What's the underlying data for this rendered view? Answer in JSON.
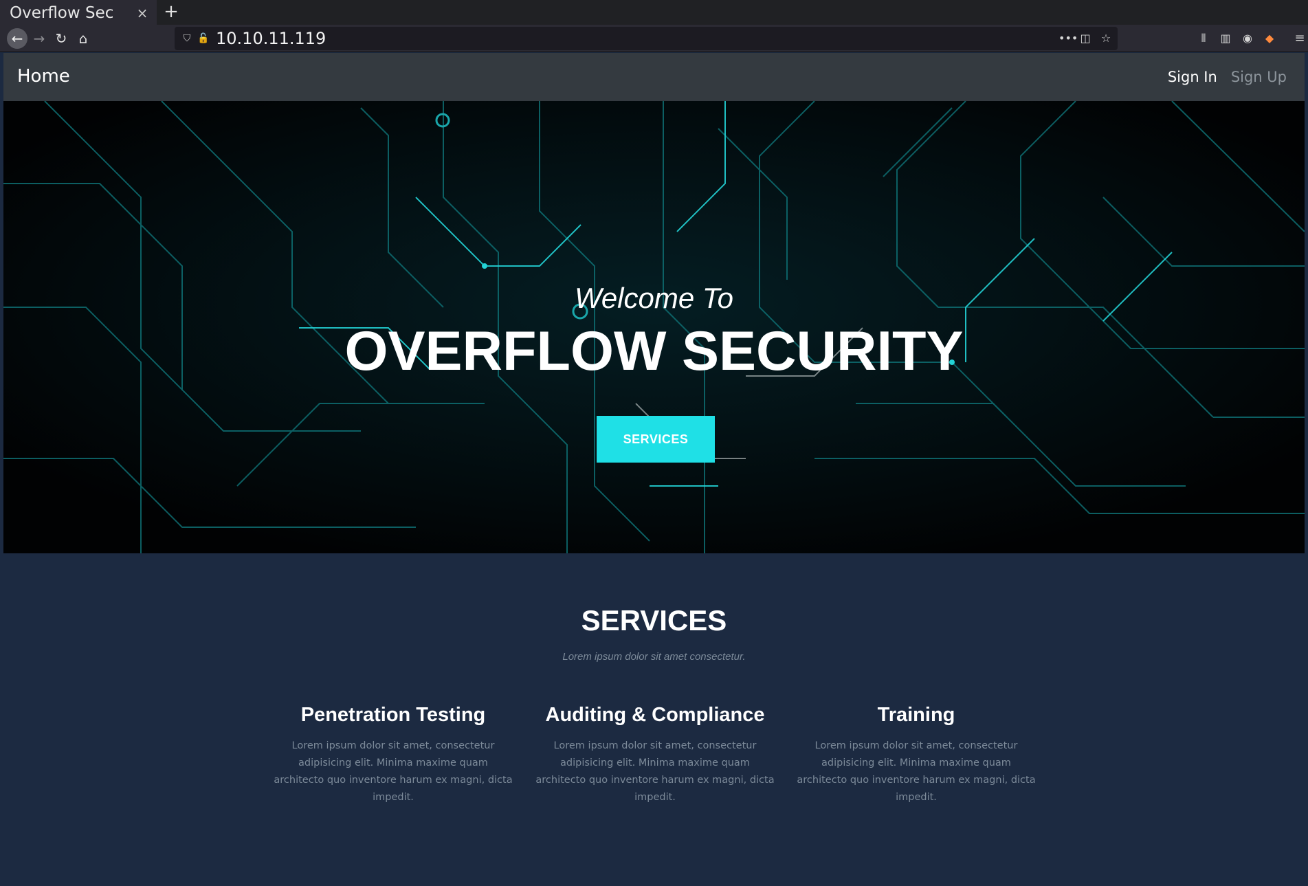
{
  "browser": {
    "tab_title": "Overflow Sec",
    "tab_close": "×",
    "new_tab": "+",
    "url": "10.10.11.119",
    "icons": {
      "back": "←",
      "forward": "→",
      "reload": "↻",
      "home": "⌂",
      "shield": "⛉",
      "insecure_lock": "🔓",
      "more": "•••",
      "pocket": "◫",
      "bookmark_star": "☆",
      "library": "⫴",
      "sidebar": "▥",
      "account": "◉",
      "extension": "◆",
      "menu": "≡"
    }
  },
  "site_nav": {
    "brand": "Home",
    "sign_in": "Sign In",
    "sign_up": "Sign Up"
  },
  "hero": {
    "welcome": "Welcome To",
    "title": "OVERFLOW SECURITY",
    "button": "SERVICES",
    "accent_color": "#1fe0e6"
  },
  "services": {
    "heading": "SERVICES",
    "subheading": "Lorem ipsum dolor sit amet consectetur.",
    "items": [
      {
        "title": "Penetration Testing",
        "text": "Lorem ipsum dolor sit amet, consectetur adipisicing elit. Minima maxime quam architecto quo inventore harum ex magni, dicta impedit."
      },
      {
        "title": "Auditing & Compliance",
        "text": "Lorem ipsum dolor sit amet, consectetur adipisicing elit. Minima maxime quam architecto quo inventore harum ex magni, dicta impedit."
      },
      {
        "title": "Training",
        "text": "Lorem ipsum dolor sit amet, consectetur adipisicing elit. Minima maxime quam architecto quo inventore harum ex magni, dicta impedit."
      }
    ]
  }
}
